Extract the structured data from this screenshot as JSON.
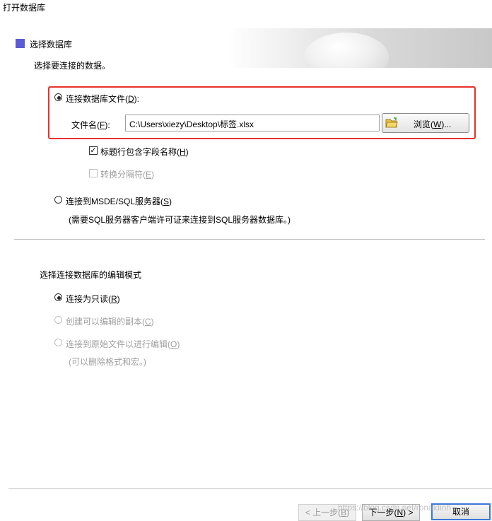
{
  "window": {
    "title": "打开数据库"
  },
  "section": {
    "title": "选择数据库",
    "subtitle": "选择要连接的数据。"
  },
  "connect_file": {
    "label_pre": "连接数据库文件(",
    "mnemonic": "D",
    "label_post": "):",
    "selected": true,
    "filename_label_pre": "文件名(",
    "filename_mnemonic": "F",
    "filename_label_post": "):",
    "filename_value": "C:\\Users\\xiezy\\Desktop\\标签.xlsx",
    "browse_pre": "浏览(",
    "browse_mnemonic": "W",
    "browse_post": ")..."
  },
  "options": {
    "header_row": {
      "pre": "标题行包含字段名称(",
      "mn": "H",
      "post": ")",
      "checked": true
    },
    "convert_sep": {
      "pre": "转换分隔符(",
      "mn": "E",
      "post": ")",
      "checked": false
    }
  },
  "connect_server": {
    "pre": "连接到MSDE/SQL服务器(",
    "mn": "S",
    "post": ")",
    "note": "(需要SQL服务器客户端许可证来连接到SQL服务器数据库。)"
  },
  "edit_mode": {
    "title": "选择连接数据库的编辑模式",
    "readonly": {
      "pre": "连接为只读(",
      "mn": "R",
      "post": ")"
    },
    "copy": {
      "pre": "创建可以编辑的副本(",
      "mn": "C",
      "post": ")"
    },
    "original": {
      "pre": "连接到原始文件以进行编辑(",
      "mn": "O",
      "post": ")"
    },
    "note": "(可以删除格式和宏。)"
  },
  "footer": {
    "back": {
      "pre": "< 上一步(",
      "mn": "B",
      "post": ")"
    },
    "next": {
      "pre": "下一步(",
      "mn": "N",
      "post": ") >"
    },
    "cancel": "取消",
    "watermark": "https://blog.csdn.net/ronaldinh"
  }
}
